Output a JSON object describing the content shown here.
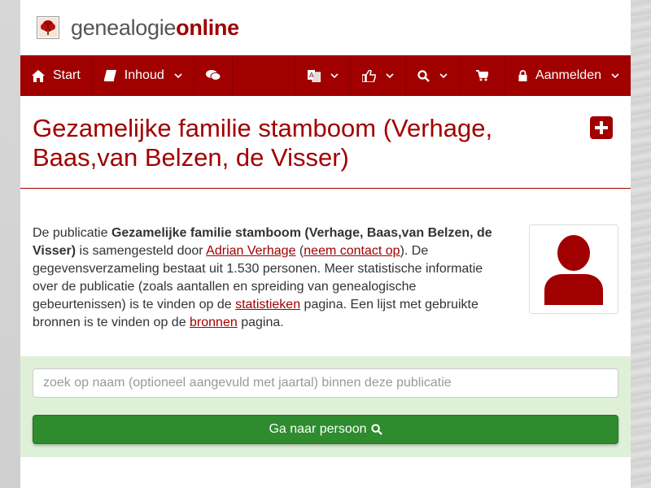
{
  "brand": {
    "name_part1": "genealogie",
    "name_part2": "online",
    "logo_icon": "tree-icon"
  },
  "nav": {
    "start": "Start",
    "inhoud": "Inhoud",
    "aanmelden": "Aanmelden"
  },
  "title": "Gezamelijke familie stamboom (Verhage, Baas,van Belzen, de Visser)",
  "description": {
    "intro": "De publicatie ",
    "pub_name": "Gezamelijke familie stamboom (Verhage, Baas,van Belzen, de Visser)",
    "part2": " is samengesteld door ",
    "author": "Adrian Verhage",
    "part3": " (",
    "contact": "neem contact op",
    "part4": "). De gegevensverzameling bestaat uit 1.530 personen. Meer statistische informatie over de publicatie (zoals aantallen en spreiding van genealogische gebeurtenissen) is te vinden op de ",
    "stats_link": "statistieken",
    "part5": " pagina. Een lijst met gebruikte bronnen is te vinden op de ",
    "sources_link": "bronnen",
    "part6": " pagina."
  },
  "search": {
    "placeholder": "zoek op naam (optioneel aangevuld met jaartal) binnen deze publicatie",
    "button": "Ga naar persoon"
  },
  "colors": {
    "brand_red": "#a10000",
    "success_green": "#2e8b2e",
    "search_bg": "#dff0d8"
  }
}
